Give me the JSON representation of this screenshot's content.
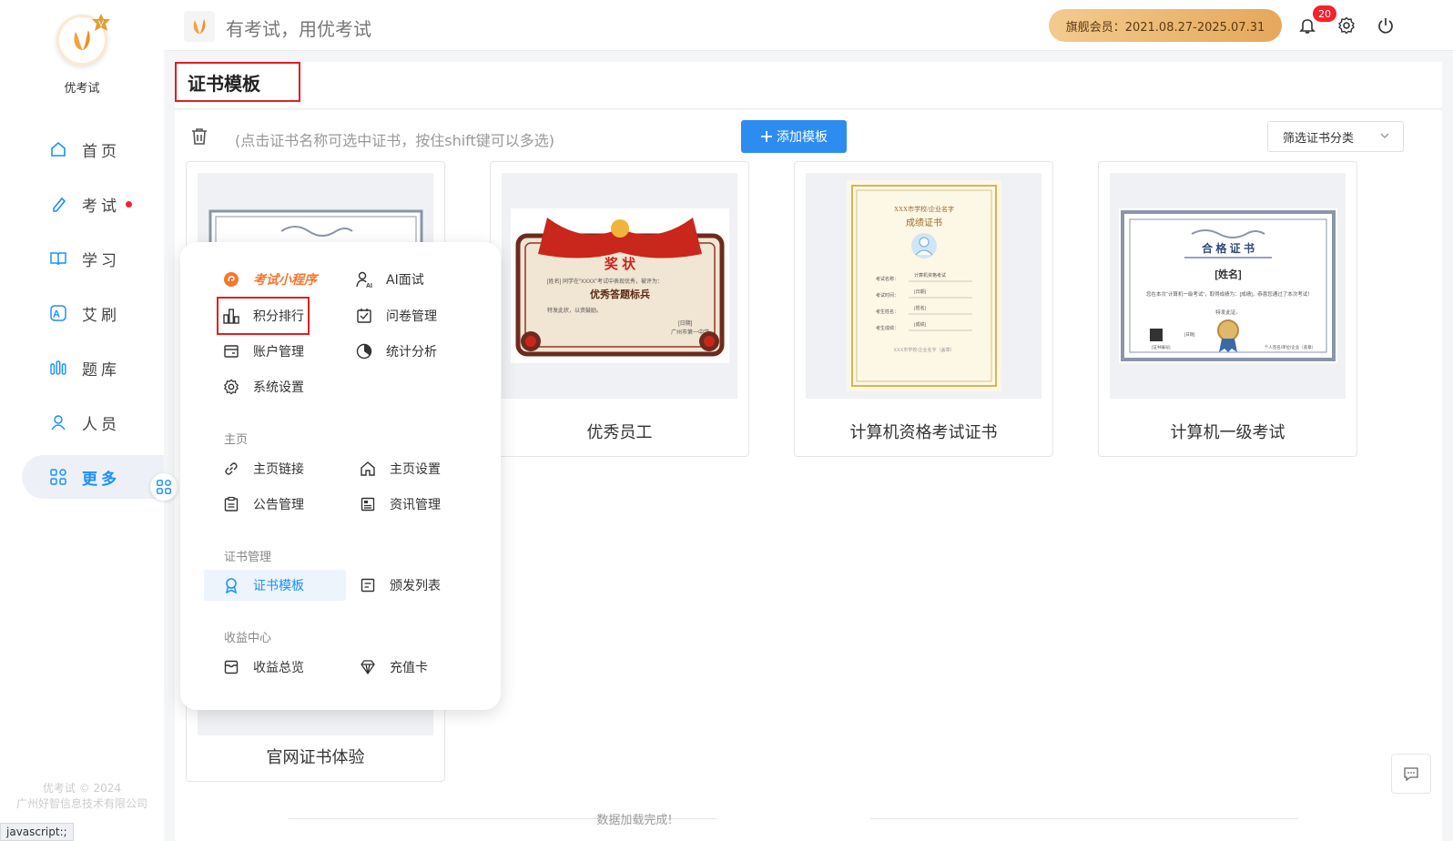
{
  "app": {
    "brand_name": "优考试",
    "header_title": "有考试，用优考试",
    "member_text": "旗舰会员：2021.08.27-2025.07.31",
    "notification_count": "20",
    "copyright_line1": "优考试 © 2024",
    "copyright_line2": "广州好智信息技术有限公司",
    "status_url": "javascript:;"
  },
  "sidebar": {
    "items": [
      {
        "label": "首页",
        "icon": "home-icon"
      },
      {
        "label": "考试",
        "icon": "exam-icon",
        "dot": true
      },
      {
        "label": "学习",
        "icon": "book-icon"
      },
      {
        "label": "艾刷",
        "icon": "ai-icon"
      },
      {
        "label": "题库",
        "icon": "question-bank-icon"
      },
      {
        "label": "人员",
        "icon": "user-icon"
      },
      {
        "label": "更多",
        "icon": "more-icon",
        "active": true
      }
    ]
  },
  "page": {
    "title": "证书模板",
    "hint": "(点击证书名称可选中证书，按住shift键可以多选)",
    "add_button": "添加模板",
    "filter_placeholder": "筛选证书分类",
    "loaded_text": "数据加载完成!"
  },
  "cards": [
    {
      "name": "官网证书体验"
    },
    {
      "name": "优秀员工",
      "cert_title": "奖  状",
      "cert_sub": "优秀答题标兵",
      "cert_text": "[姓名] 同学在“XXXX”考试中表现优秀，被评为：",
      "cert_note": "特发此状，以资鼓励。",
      "cert_date": "[日期]",
      "cert_org": "广州市第一中学"
    },
    {
      "name": "计算机资格考试证书",
      "cert_org": "XXX市学校/企业名字",
      "cert_title": "成绩证书",
      "fields": [
        "考试名称：",
        "考试时间：",
        "考生姓名：",
        "考生成绩："
      ],
      "values": [
        "计算机资格考试",
        "[日期]",
        "[姓名]",
        "[成绩]"
      ],
      "cert_foot": "XXX市学校/企业名字（盖章）"
    },
    {
      "name": "计算机一级考试",
      "cert_title": "合 格 证 书",
      "cert_name": "[姓名]",
      "cert_text": "您在本次“计算机一级考试”，取得成绩为：[成绩]，恭喜您通过了本次考试！",
      "cert_note": "特发此证。",
      "cert_date": "[日期]",
      "cert_cert": "[证书编号]",
      "cert_org": "个人签名/单位/企业（盖章）"
    }
  ],
  "popup": {
    "mini_program": "考试小程序",
    "ai_interview": "AI面试",
    "points_rank": "积分排行",
    "paper_manage": "问卷管理",
    "account_manage": "账户管理",
    "stats_analysis": "统计分析",
    "system_settings": "系统设置",
    "section_home": "主页",
    "home_link": "主页链接",
    "home_settings": "主页设置",
    "notice_manage": "公告管理",
    "news_manage": "资讯管理",
    "section_cert": "证书管理",
    "cert_template": "证书模板",
    "issue_list": "颁发列表",
    "section_income": "收益中心",
    "income_overview": "收益总览",
    "recharge_card": "充值卡"
  },
  "colors": {
    "accent": "#1890ff",
    "button": "#2d8cf0",
    "alert_red": "#e02020",
    "gold_start": "#f3cb8f",
    "gold_end": "#e5a75b"
  }
}
